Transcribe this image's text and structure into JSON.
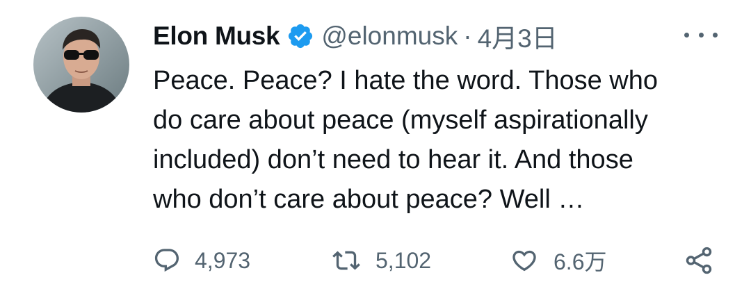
{
  "tweet": {
    "author": {
      "display_name": "Elon Musk",
      "verified": true,
      "handle": "@elonmusk",
      "separator": "·",
      "date": "4月3日"
    },
    "text_lines": [
      "Peace. Peace?  I hate the word. Those who",
      "do care about peace (myself aspirationally",
      "included) don’t need to hear it. And those",
      "who don’t care about peace? Well …"
    ],
    "actions": {
      "reply": {
        "icon": "reply-icon",
        "count": "4,973"
      },
      "retweet": {
        "icon": "retweet-icon",
        "count": "5,102"
      },
      "like": {
        "icon": "heart-icon",
        "count": "6.6万"
      },
      "share": {
        "icon": "share-icon"
      }
    }
  },
  "colors": {
    "primary_text": "#0f1419",
    "secondary_text": "#536471",
    "verified_blue": "#1d9bf0"
  }
}
